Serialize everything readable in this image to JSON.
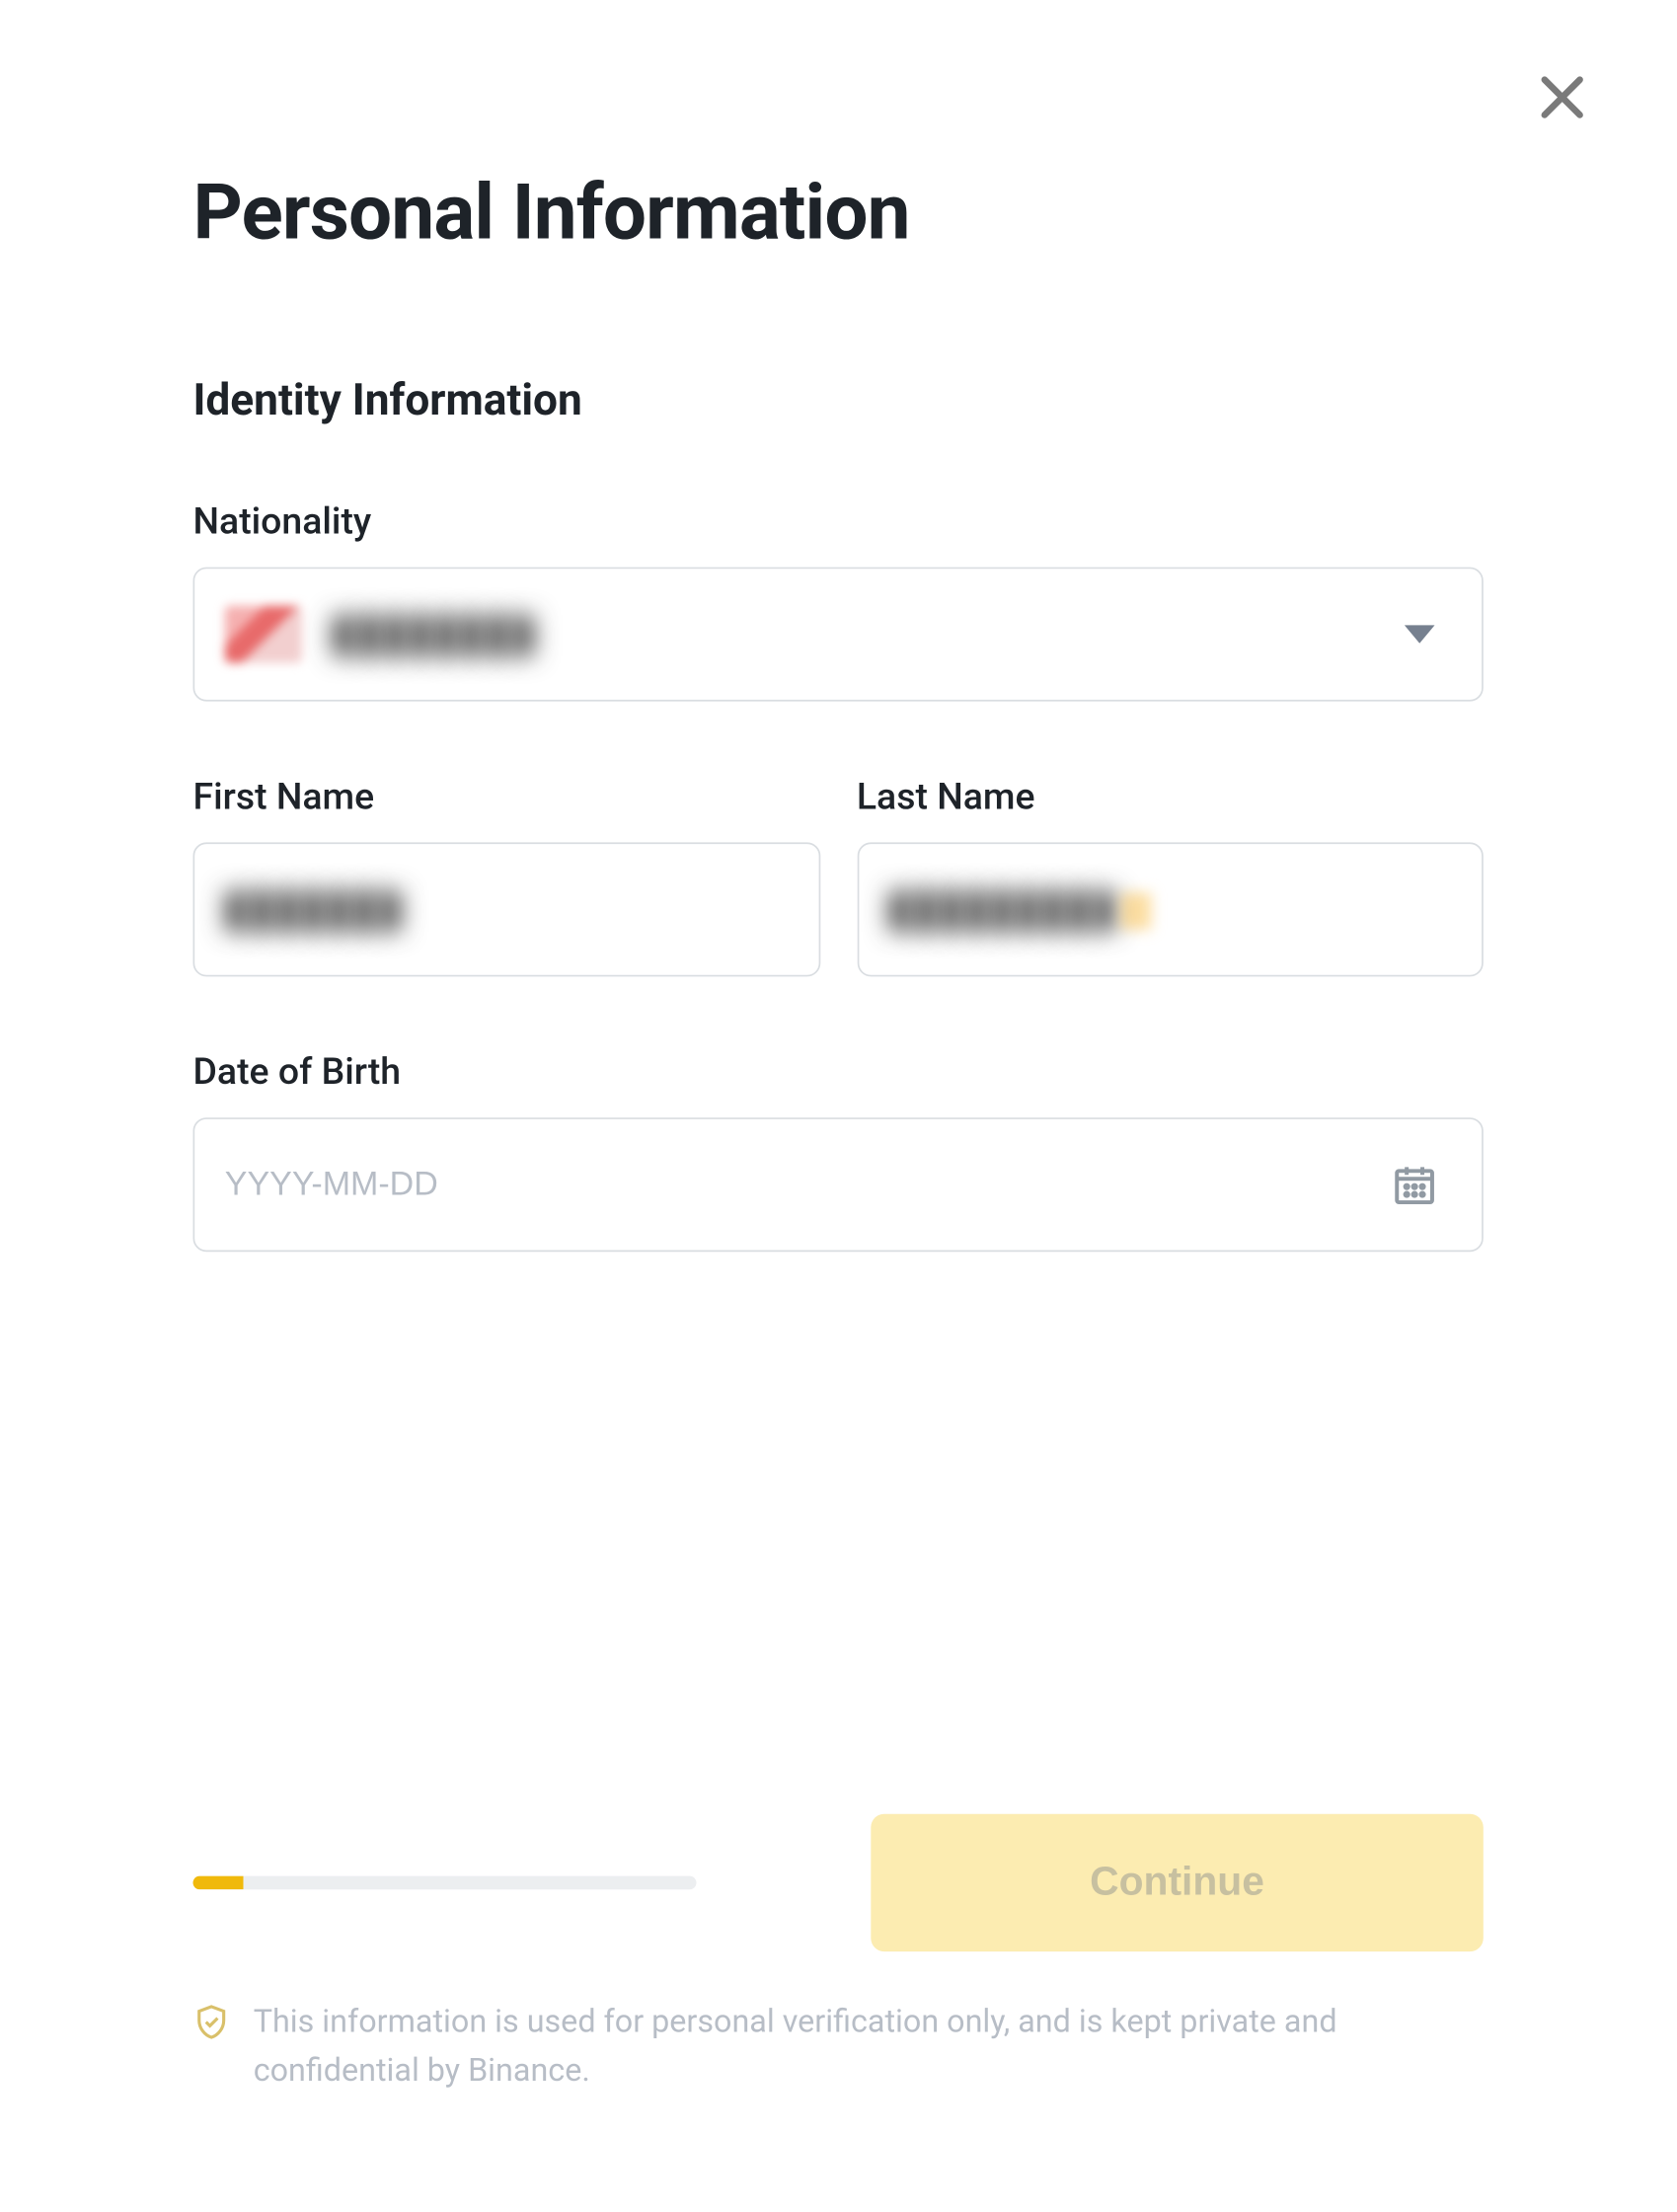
{
  "title": "Personal Information",
  "sectionTitle": "Identity Information",
  "nationality": {
    "label": "Nationality",
    "valueRedacted": "████████"
  },
  "firstName": {
    "label": "First Name",
    "valueRedacted": "███████"
  },
  "lastName": {
    "label": "Last Name",
    "valueRedacted": "█████████"
  },
  "dob": {
    "label": "Date of Birth",
    "placeholder": "YYYY-MM-DD",
    "value": ""
  },
  "progress": {
    "percent": 10
  },
  "continueLabel": "Continue",
  "disclaimer": "This information is used for personal verification only, and is kept private and confidential by Binance."
}
